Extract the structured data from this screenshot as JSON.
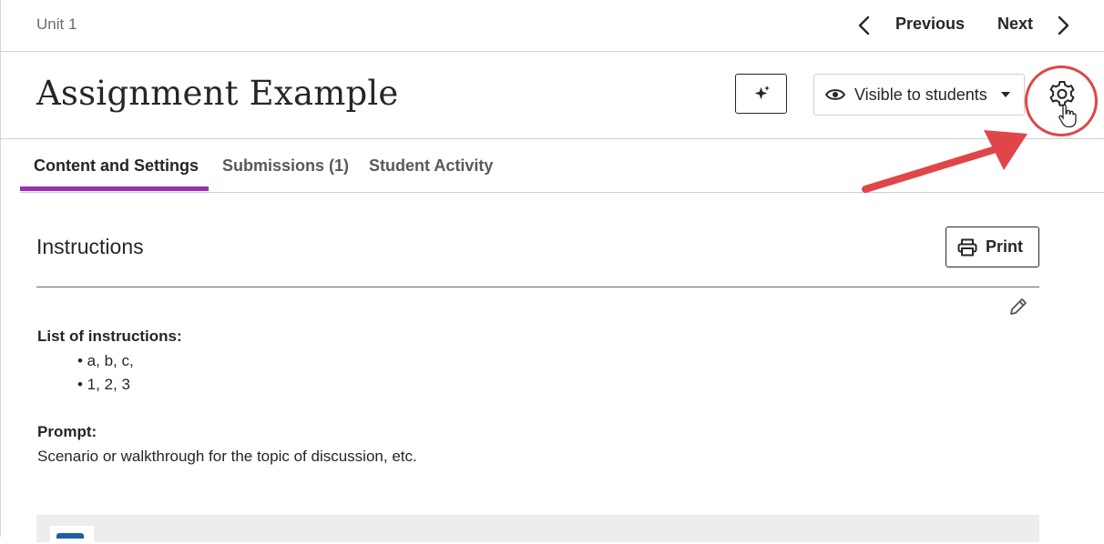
{
  "topbar": {
    "breadcrumb": "Unit 1",
    "previous_label": "Previous",
    "next_label": "Next"
  },
  "header": {
    "title": "Assignment Example",
    "visibility_label": "Visible to students"
  },
  "tabs": [
    {
      "label": "Content and Settings",
      "active": true
    },
    {
      "label": "Submissions (1)",
      "active": false
    },
    {
      "label": "Student Activity",
      "active": false
    }
  ],
  "content": {
    "section_title": "Instructions",
    "print_label": "Print",
    "list_title": "List of instructions:",
    "bullets": [
      "• a, b, c,",
      "• 1, 2, 3"
    ],
    "prompt_title": "Prompt:",
    "prompt_text": "Scenario or walkthrough for the topic of discussion, etc."
  },
  "colors": {
    "accent_tab": "#9a2fb3",
    "highlight": "#e0454a",
    "text": "#262626"
  },
  "icons": [
    "chevron-left-icon",
    "chevron-right-icon",
    "sparkle-icon",
    "eye-icon",
    "caret-down-icon",
    "gear-icon",
    "hand-cursor-icon",
    "printer-icon",
    "pencil-icon",
    "document-icon"
  ]
}
